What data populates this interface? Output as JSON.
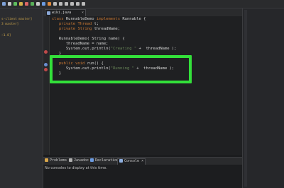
{
  "left_panel": {
    "items": [
      "s-client master]",
      "3 master]",
      "~1.8]"
    ]
  },
  "editor": {
    "tab": {
      "label": "wiki.java",
      "close": "×"
    },
    "lines": [
      {
        "num": "1",
        "text": "class RunnableDemo implements Runnable {"
      },
      {
        "num": "2",
        "text": "   private Thread t;"
      },
      {
        "num": "3",
        "text": "   private String threadName;"
      },
      {
        "num": "4",
        "text": ""
      },
      {
        "num": "5",
        "text": "   RunnableDemo( String name) {"
      },
      {
        "num": "6",
        "text": "      threadName = name;"
      },
      {
        "num": "7",
        "text": "      System.out.println(\"Creating \" +  threadName );"
      },
      {
        "num": "8",
        "text": "   }"
      },
      {
        "num": "9",
        "text": ""
      },
      {
        "num": "10",
        "text": "   public void run() {"
      },
      {
        "num": "11",
        "text": "      System.out.println(\"Running \" +  threadName );"
      },
      {
        "num": "12",
        "text": "   }"
      }
    ],
    "highlight_color": "#33e03a"
  },
  "bottom_panel": {
    "tabs": [
      {
        "label": "Problems",
        "icon": "problems-icon"
      },
      {
        "label": "Javadoc",
        "icon": "javadoc-icon"
      },
      {
        "label": "Declaration",
        "icon": "declaration-icon"
      },
      {
        "label": "Console",
        "icon": "console-icon",
        "close": "×",
        "active": true
      }
    ],
    "console_message": "No consoles to display at this time."
  }
}
